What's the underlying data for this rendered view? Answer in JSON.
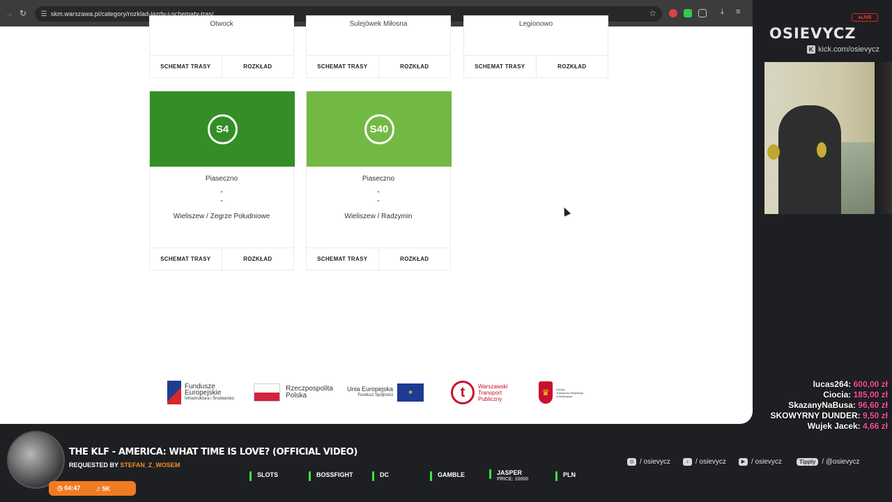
{
  "browser": {
    "url": "skm.warszawa.pl/category/rozklad-jazdy-i-schematy-tras/"
  },
  "page": {
    "top_cards": [
      {
        "partial_text": "Otwock",
        "scheme_label": "SCHEMAT TRASY",
        "timetable_label": "ROZKŁAD"
      },
      {
        "partial_text": "Sulejówek Miłosna",
        "scheme_label": "SCHEMAT TRASY",
        "timetable_label": "ROZKŁAD"
      },
      {
        "partial_text": "Legionowo",
        "scheme_label": "SCHEMAT TRASY",
        "timetable_label": "ROZKŁAD"
      }
    ],
    "line_cards": [
      {
        "line": "S4",
        "color": "#338e26",
        "from": "Piaseczno",
        "to": "Wieliszew / Zegrze Południowe",
        "arrow_up": "⌃",
        "arrow_down": "⌄",
        "scheme_label": "SCHEMAT TRASY",
        "timetable_label": "ROZKŁAD"
      },
      {
        "line": "S40",
        "color": "#72b944",
        "from": "Piaseczno",
        "to": "Wieliszew / Radzymin",
        "arrow_up": "⌃",
        "arrow_down": "⌄",
        "scheme_label": "SCHEMAT TRASY",
        "timetable_label": "ROZKŁAD"
      }
    ]
  },
  "footer_logos": {
    "fe": {
      "line1": "Fundusze",
      "line2": "Europejskie",
      "line3": "Infrastruktura i Środowisko"
    },
    "pl": {
      "line1": "Rzeczpospolita",
      "line2": "Polska"
    },
    "eu": {
      "line1": "Unia Europejska",
      "line2": "Fundusz Spójności",
      "stars": "✶"
    },
    "wtp": {
      "mark": "t",
      "line1": "Warszawski",
      "line2": "Transport",
      "line3": "Publiczny"
    },
    "ztm": {
      "line1": "Zarząd",
      "line2": "Transportu Miejskiego",
      "line3": "w Warszawie"
    }
  },
  "overlay": {
    "live": "●LIVE",
    "channel": "OSIEVYCZ",
    "kick_url": "kick.com/osievycz",
    "kick_icon": "K",
    "donations": [
      {
        "name": "lucas264:",
        "amount": "600,00 zł"
      },
      {
        "name": "Ciocia:",
        "amount": "185,00 zł"
      },
      {
        "name": "SkazanyNaBusa:",
        "amount": "96,60 zł"
      },
      {
        "name": "SKOWYRNY DUNDER:",
        "amount": "9,50 zł"
      },
      {
        "name": "Wujek Jacek:",
        "amount": "4,66 zł"
      }
    ],
    "song": {
      "title": "THE KLF - AMERICA: WHAT TIME IS LOVE? (OFFICIAL VIDEO)",
      "requested_by": "REQUESTED BY",
      "requester": "STEFAN_Z_WOSEM",
      "time": "04:47",
      "queue": "5K",
      "time_icon": "◷",
      "queue_icon": "♫"
    },
    "commands": [
      {
        "label": "SLOTS",
        "sub": ""
      },
      {
        "label": "BOSSFIGHT",
        "sub": ""
      },
      {
        "label": "DC",
        "sub": ""
      },
      {
        "label": "GAMBLE",
        "sub": ""
      },
      {
        "label": "JASPER",
        "sub": "PRICE: 10000"
      },
      {
        "label": "PLN",
        "sub": ""
      }
    ],
    "socials": {
      "instagram": "/ osievycz",
      "tiktok": "/ osievycz",
      "youtube": "/ osievycz",
      "tipply_label": "Tipply",
      "tipply": "/ @osievycz"
    }
  }
}
